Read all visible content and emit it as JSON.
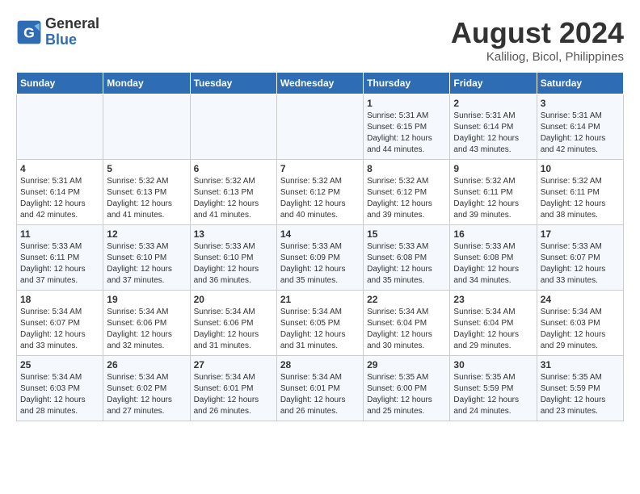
{
  "header": {
    "logo_line1": "General",
    "logo_line2": "Blue",
    "month_title": "August 2024",
    "subtitle": "Kaliliog, Bicol, Philippines"
  },
  "days_of_week": [
    "Sunday",
    "Monday",
    "Tuesday",
    "Wednesday",
    "Thursday",
    "Friday",
    "Saturday"
  ],
  "weeks": [
    [
      {
        "day": "",
        "sunrise": "",
        "sunset": "",
        "daylight": ""
      },
      {
        "day": "",
        "sunrise": "",
        "sunset": "",
        "daylight": ""
      },
      {
        "day": "",
        "sunrise": "",
        "sunset": "",
        "daylight": ""
      },
      {
        "day": "",
        "sunrise": "",
        "sunset": "",
        "daylight": ""
      },
      {
        "day": "1",
        "sunrise": "Sunrise: 5:31 AM",
        "sunset": "Sunset: 6:15 PM",
        "daylight": "Daylight: 12 hours and 44 minutes."
      },
      {
        "day": "2",
        "sunrise": "Sunrise: 5:31 AM",
        "sunset": "Sunset: 6:14 PM",
        "daylight": "Daylight: 12 hours and 43 minutes."
      },
      {
        "day": "3",
        "sunrise": "Sunrise: 5:31 AM",
        "sunset": "Sunset: 6:14 PM",
        "daylight": "Daylight: 12 hours and 42 minutes."
      }
    ],
    [
      {
        "day": "4",
        "sunrise": "Sunrise: 5:31 AM",
        "sunset": "Sunset: 6:14 PM",
        "daylight": "Daylight: 12 hours and 42 minutes."
      },
      {
        "day": "5",
        "sunrise": "Sunrise: 5:32 AM",
        "sunset": "Sunset: 6:13 PM",
        "daylight": "Daylight: 12 hours and 41 minutes."
      },
      {
        "day": "6",
        "sunrise": "Sunrise: 5:32 AM",
        "sunset": "Sunset: 6:13 PM",
        "daylight": "Daylight: 12 hours and 41 minutes."
      },
      {
        "day": "7",
        "sunrise": "Sunrise: 5:32 AM",
        "sunset": "Sunset: 6:12 PM",
        "daylight": "Daylight: 12 hours and 40 minutes."
      },
      {
        "day": "8",
        "sunrise": "Sunrise: 5:32 AM",
        "sunset": "Sunset: 6:12 PM",
        "daylight": "Daylight: 12 hours and 39 minutes."
      },
      {
        "day": "9",
        "sunrise": "Sunrise: 5:32 AM",
        "sunset": "Sunset: 6:11 PM",
        "daylight": "Daylight: 12 hours and 39 minutes."
      },
      {
        "day": "10",
        "sunrise": "Sunrise: 5:32 AM",
        "sunset": "Sunset: 6:11 PM",
        "daylight": "Daylight: 12 hours and 38 minutes."
      }
    ],
    [
      {
        "day": "11",
        "sunrise": "Sunrise: 5:33 AM",
        "sunset": "Sunset: 6:11 PM",
        "daylight": "Daylight: 12 hours and 37 minutes."
      },
      {
        "day": "12",
        "sunrise": "Sunrise: 5:33 AM",
        "sunset": "Sunset: 6:10 PM",
        "daylight": "Daylight: 12 hours and 37 minutes."
      },
      {
        "day": "13",
        "sunrise": "Sunrise: 5:33 AM",
        "sunset": "Sunset: 6:10 PM",
        "daylight": "Daylight: 12 hours and 36 minutes."
      },
      {
        "day": "14",
        "sunrise": "Sunrise: 5:33 AM",
        "sunset": "Sunset: 6:09 PM",
        "daylight": "Daylight: 12 hours and 35 minutes."
      },
      {
        "day": "15",
        "sunrise": "Sunrise: 5:33 AM",
        "sunset": "Sunset: 6:08 PM",
        "daylight": "Daylight: 12 hours and 35 minutes."
      },
      {
        "day": "16",
        "sunrise": "Sunrise: 5:33 AM",
        "sunset": "Sunset: 6:08 PM",
        "daylight": "Daylight: 12 hours and 34 minutes."
      },
      {
        "day": "17",
        "sunrise": "Sunrise: 5:33 AM",
        "sunset": "Sunset: 6:07 PM",
        "daylight": "Daylight: 12 hours and 33 minutes."
      }
    ],
    [
      {
        "day": "18",
        "sunrise": "Sunrise: 5:34 AM",
        "sunset": "Sunset: 6:07 PM",
        "daylight": "Daylight: 12 hours and 33 minutes."
      },
      {
        "day": "19",
        "sunrise": "Sunrise: 5:34 AM",
        "sunset": "Sunset: 6:06 PM",
        "daylight": "Daylight: 12 hours and 32 minutes."
      },
      {
        "day": "20",
        "sunrise": "Sunrise: 5:34 AM",
        "sunset": "Sunset: 6:06 PM",
        "daylight": "Daylight: 12 hours and 31 minutes."
      },
      {
        "day": "21",
        "sunrise": "Sunrise: 5:34 AM",
        "sunset": "Sunset: 6:05 PM",
        "daylight": "Daylight: 12 hours and 31 minutes."
      },
      {
        "day": "22",
        "sunrise": "Sunrise: 5:34 AM",
        "sunset": "Sunset: 6:04 PM",
        "daylight": "Daylight: 12 hours and 30 minutes."
      },
      {
        "day": "23",
        "sunrise": "Sunrise: 5:34 AM",
        "sunset": "Sunset: 6:04 PM",
        "daylight": "Daylight: 12 hours and 29 minutes."
      },
      {
        "day": "24",
        "sunrise": "Sunrise: 5:34 AM",
        "sunset": "Sunset: 6:03 PM",
        "daylight": "Daylight: 12 hours and 29 minutes."
      }
    ],
    [
      {
        "day": "25",
        "sunrise": "Sunrise: 5:34 AM",
        "sunset": "Sunset: 6:03 PM",
        "daylight": "Daylight: 12 hours and 28 minutes."
      },
      {
        "day": "26",
        "sunrise": "Sunrise: 5:34 AM",
        "sunset": "Sunset: 6:02 PM",
        "daylight": "Daylight: 12 hours and 27 minutes."
      },
      {
        "day": "27",
        "sunrise": "Sunrise: 5:34 AM",
        "sunset": "Sunset: 6:01 PM",
        "daylight": "Daylight: 12 hours and 26 minutes."
      },
      {
        "day": "28",
        "sunrise": "Sunrise: 5:34 AM",
        "sunset": "Sunset: 6:01 PM",
        "daylight": "Daylight: 12 hours and 26 minutes."
      },
      {
        "day": "29",
        "sunrise": "Sunrise: 5:35 AM",
        "sunset": "Sunset: 6:00 PM",
        "daylight": "Daylight: 12 hours and 25 minutes."
      },
      {
        "day": "30",
        "sunrise": "Sunrise: 5:35 AM",
        "sunset": "Sunset: 5:59 PM",
        "daylight": "Daylight: 12 hours and 24 minutes."
      },
      {
        "day": "31",
        "sunrise": "Sunrise: 5:35 AM",
        "sunset": "Sunset: 5:59 PM",
        "daylight": "Daylight: 12 hours and 23 minutes."
      }
    ]
  ]
}
